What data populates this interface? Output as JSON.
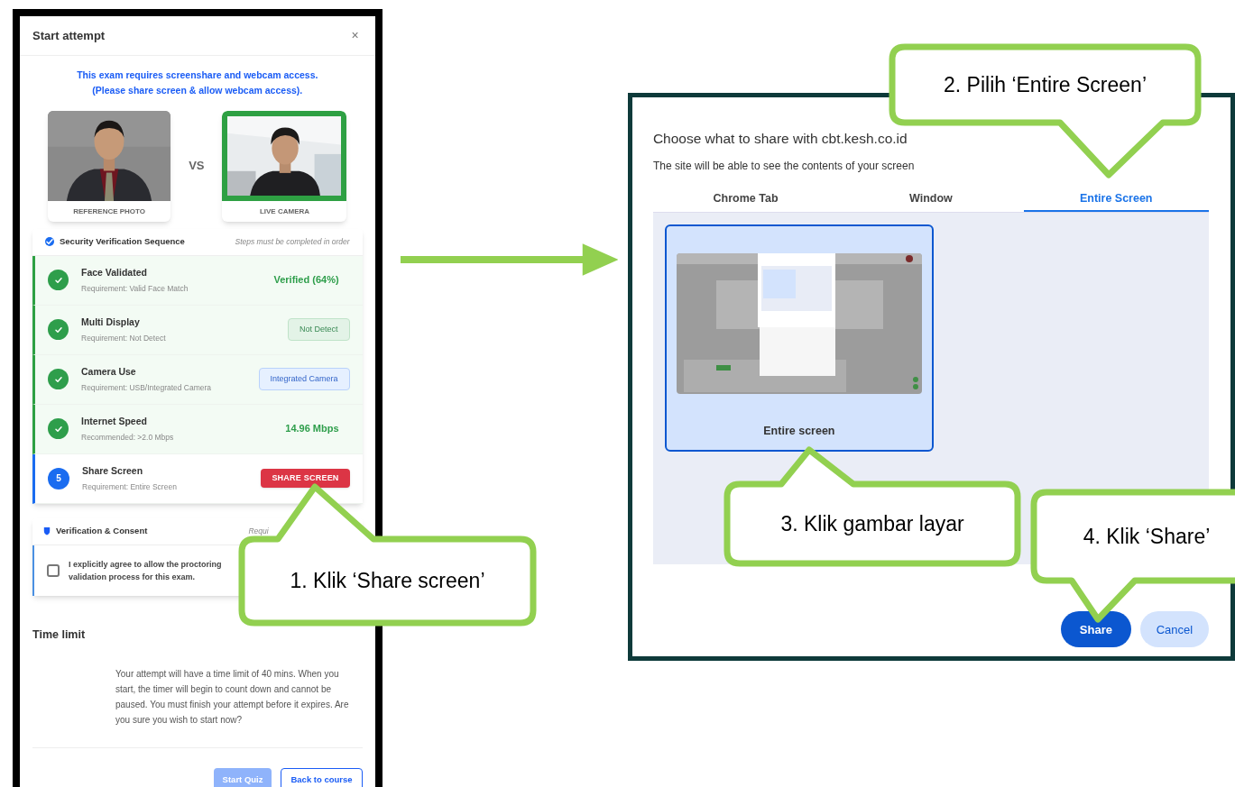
{
  "quiz_modal": {
    "title": "Start attempt",
    "close": "×",
    "notice": [
      "This exam requires screenshare and webcam access.",
      "(Please share screen & allow webcam access)."
    ],
    "reference_label": "REFERENCE PHOTO",
    "vs": "VS",
    "live_label": "LIVE CAMERA",
    "security": {
      "title": "Security Verification Sequence",
      "note": "Steps must be completed in order",
      "steps": [
        {
          "title": "Face Validated",
          "requirement": "Requirement: Valid Face Match",
          "done": true,
          "kind": "value",
          "status": "Verified (64%)"
        },
        {
          "title": "Multi Display",
          "requirement": "Requirement: Not Detect",
          "done": true,
          "kind": "okbadge",
          "status": "Not Detect"
        },
        {
          "title": "Camera Use",
          "requirement": "Requirement: USB/Integrated Camera",
          "done": true,
          "kind": "infobadge",
          "status": "Integrated Camera"
        },
        {
          "title": "Internet Speed",
          "requirement": "Recommended: >2.0 Mbps",
          "done": true,
          "kind": "value",
          "status": "14.96 Mbps"
        },
        {
          "title": "Share Screen",
          "requirement": "Requirement: Entire Screen",
          "done": false,
          "number": "5",
          "kind": "button",
          "status": "SHARE SCREEN"
        }
      ]
    },
    "consent": {
      "title": "Verification & Consent",
      "note": "Requi",
      "text": "I explicitly agree to allow the proctoring validation process for this exam.",
      "checked": false
    },
    "time_limit": {
      "title": "Time limit",
      "text": "Your attempt will have a time limit of 40 mins. When you start, the timer will begin to count down and cannot be paused. You must finish your attempt before it expires. Are you sure you wish to start now?"
    },
    "buttons": [
      {
        "label": "Start Quiz",
        "disabled": true
      },
      {
        "label": "Back to course",
        "disabled": false
      }
    ]
  },
  "share_dialog": {
    "title": "Choose what to share with cbt.kesh.co.id",
    "subtitle": "The site will be able to see the contents of your screen",
    "tabs": [
      {
        "label": "Chrome Tab",
        "selected": false
      },
      {
        "label": "Window",
        "selected": false
      },
      {
        "label": "Entire Screen",
        "selected": true
      }
    ],
    "sources": [
      {
        "label": "Entire screen",
        "selected": true
      }
    ],
    "buttons": [
      {
        "label": "Share",
        "kind": "primary"
      },
      {
        "label": "Cancel",
        "kind": "secondary"
      }
    ]
  },
  "callouts": [
    {
      "text": "1. Klik ‘Share screen’"
    },
    {
      "text": "2. Pilih ‘Entire Screen’"
    },
    {
      "text": "3. Klik gambar layar"
    },
    {
      "text": "4. Klik ‘Share’"
    }
  ]
}
